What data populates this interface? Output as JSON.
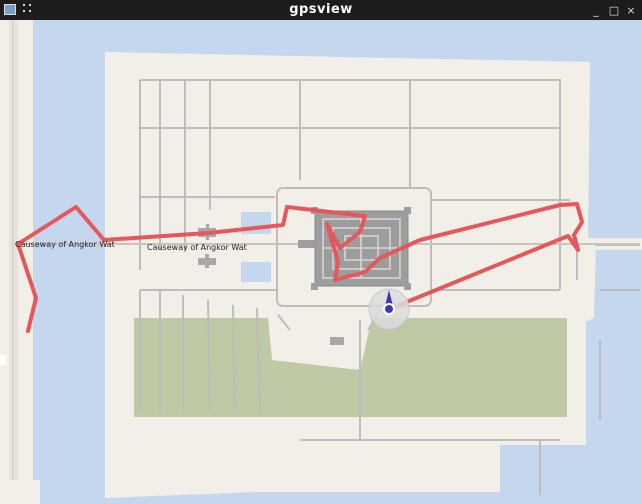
{
  "window": {
    "title": "gpsview",
    "minimize_glyph": "_",
    "maximize_glyph": "□",
    "close_glyph": "×"
  },
  "map": {
    "labels": {
      "causeway_west": "Causeway of Angkor Wat",
      "causeway_east": "Causeway of Angkor Wat"
    },
    "colors": {
      "water": "#c5d7ef",
      "land": "#f2efe9",
      "paths": "#bdbdbd",
      "park": "#bfc9a5",
      "temple": "#9d9d9d",
      "track": "#e5575b",
      "position_marker": "#3a3ab8"
    }
  }
}
